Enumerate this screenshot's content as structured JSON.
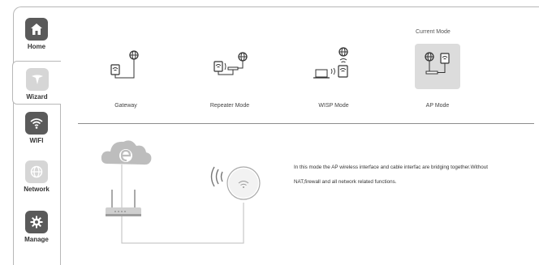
{
  "sidebar": {
    "items": [
      {
        "label": "Home",
        "icon": "home-icon"
      },
      {
        "label": "Wizard",
        "icon": "wizard-icon"
      },
      {
        "label": "WIFI",
        "icon": "wifi-icon"
      },
      {
        "label": "Network",
        "icon": "globe-icon"
      },
      {
        "label": "Manage",
        "icon": "gear-icon"
      }
    ],
    "active_index": 1
  },
  "modes": {
    "current_label": "Current Mode",
    "items": [
      {
        "label": "Gateway"
      },
      {
        "label": "Repeater Mode"
      },
      {
        "label": "WISP Mode"
      },
      {
        "label": "AP Mode"
      }
    ],
    "current_index": 3
  },
  "diagram": {
    "cloud_icon": "internet-cloud-icon",
    "router_icon": "router-icon",
    "ap_icon": "ceiling-ap-icon"
  },
  "description": "In this mode the AP wireless interface and cable interfac are bridging together.Without NAT,firewall and all network related functions.",
  "colors": {
    "tile_dark": "#5a5a5a",
    "tile_light": "#d6d6d6",
    "current_card": "#dcdcdc"
  }
}
